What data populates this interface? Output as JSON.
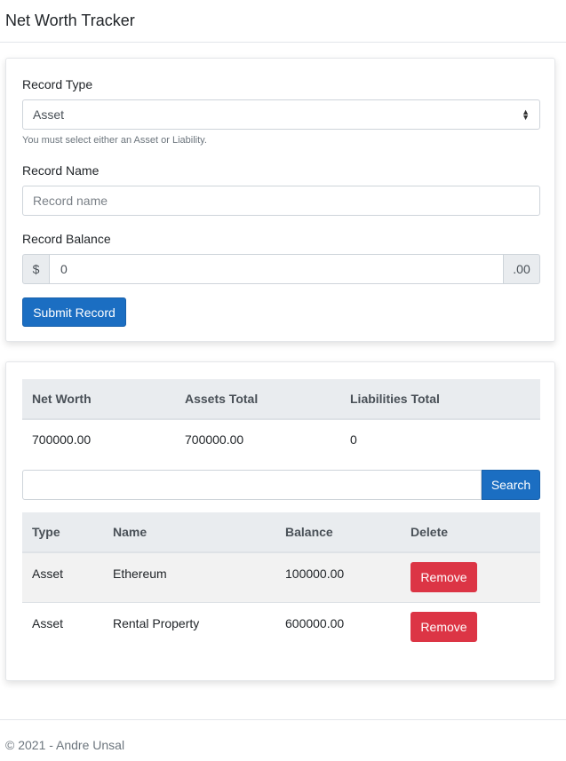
{
  "app": {
    "title": "Net Worth Tracker"
  },
  "form": {
    "record_type_label": "Record Type",
    "record_type_value": "Asset",
    "record_type_help": "You must select either an Asset or Liability.",
    "record_name_label": "Record Name",
    "record_name_placeholder": "Record name",
    "record_balance_label": "Record Balance",
    "currency_prefix": "$",
    "balance_value": "0",
    "currency_suffix": ".00",
    "submit_label": "Submit Record"
  },
  "summary": {
    "headers": [
      "Net Worth",
      "Assets Total",
      "Liabilities Total"
    ],
    "values": [
      "700000.00",
      "700000.00",
      "0"
    ]
  },
  "search": {
    "button_label": "Search",
    "value": ""
  },
  "records": {
    "headers": [
      "Type",
      "Name",
      "Balance",
      "Delete"
    ],
    "rows": [
      {
        "type": "Asset",
        "name": "Ethereum",
        "balance": "100000.00",
        "action": "Remove"
      },
      {
        "type": "Asset",
        "name": "Rental Property",
        "balance": "600000.00",
        "action": "Remove"
      }
    ]
  },
  "footer": {
    "text": "© 2021 - Andre Unsal"
  },
  "colors": {
    "primary": "#1b6ec2",
    "danger": "#dc3545",
    "header_bg": "#e9ecef"
  }
}
